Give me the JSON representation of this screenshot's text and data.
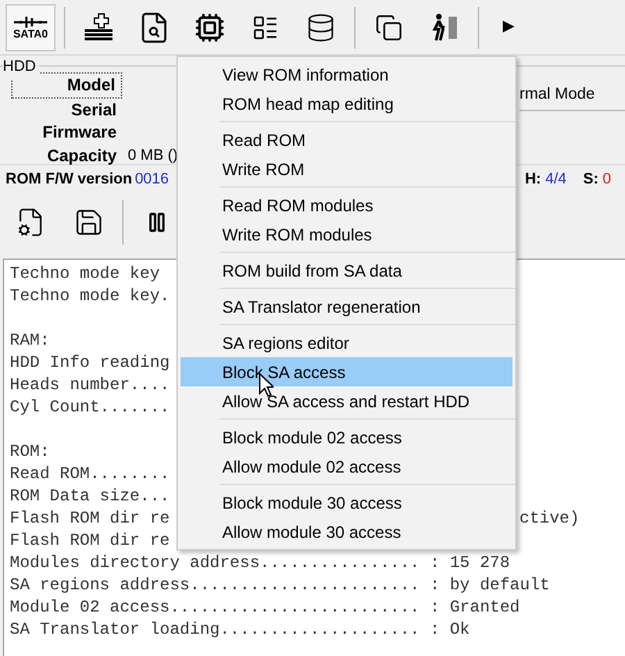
{
  "toolbar": {
    "port_label": "SATA0",
    "more": "▶"
  },
  "hdd": {
    "title": "HDD",
    "fields": [
      {
        "label": "Model"
      },
      {
        "label": "Serial"
      },
      {
        "label": "Firmware"
      },
      {
        "label": "Capacity",
        "value": "0 MB ()"
      }
    ],
    "mode": "rmal Mode"
  },
  "rom_info": {
    "label": "ROM F/W version",
    "value": "0016",
    "heads_label": "H:",
    "heads": "4/4",
    "s_label": "S:",
    "s": "0"
  },
  "log": [
    {
      "left": "Techno mode key"
    },
    {
      "left": "Techno mode key."
    },
    {
      "left": "RAM:",
      "gap_before": true
    },
    {
      "left": "HDD Info reading"
    },
    {
      "left": "Heads number...."
    },
    {
      "left": "Cyl Count......."
    },
    {
      "left": "ROM:",
      "gap_before": true
    },
    {
      "left": "Read ROM........"
    },
    {
      "left": "ROM Data size..."
    },
    {
      "left": "Flash ROM dir re",
      "right": "ctive)"
    },
    {
      "left": "Flash ROM dir re"
    },
    {
      "left": "Modules directory address................ : 15 278"
    },
    {
      "left": "SA regions address....................... : by default"
    },
    {
      "left": "Module 02 access......................... : Granted"
    },
    {
      "left": "SA Translator loading.................... : Ok"
    }
  ],
  "menu": [
    [
      {
        "label": "View ROM information",
        "selected": false
      },
      {
        "label": "ROM head map editing",
        "selected": false
      }
    ],
    [
      {
        "label": "Read ROM",
        "selected": false
      },
      {
        "label": "Write ROM",
        "selected": false
      }
    ],
    [
      {
        "label": "Read ROM modules",
        "selected": false
      },
      {
        "label": "Write ROM modules",
        "selected": false
      }
    ],
    [
      {
        "label": "ROM build from SA data",
        "selected": false
      }
    ],
    [
      {
        "label": "SA Translator regeneration",
        "selected": false
      }
    ],
    [
      {
        "label": "SA regions editor",
        "selected": false
      },
      {
        "label": "Block SA access",
        "selected": true
      },
      {
        "label": "Allow SA access and restart HDD",
        "selected": false
      }
    ],
    [
      {
        "label": "Block module 02 access",
        "selected": false
      },
      {
        "label": "Allow module 02 access",
        "selected": false
      }
    ],
    [
      {
        "label": "Block module 30 access",
        "selected": false
      },
      {
        "label": "Allow module 30 access",
        "selected": false
      }
    ]
  ]
}
